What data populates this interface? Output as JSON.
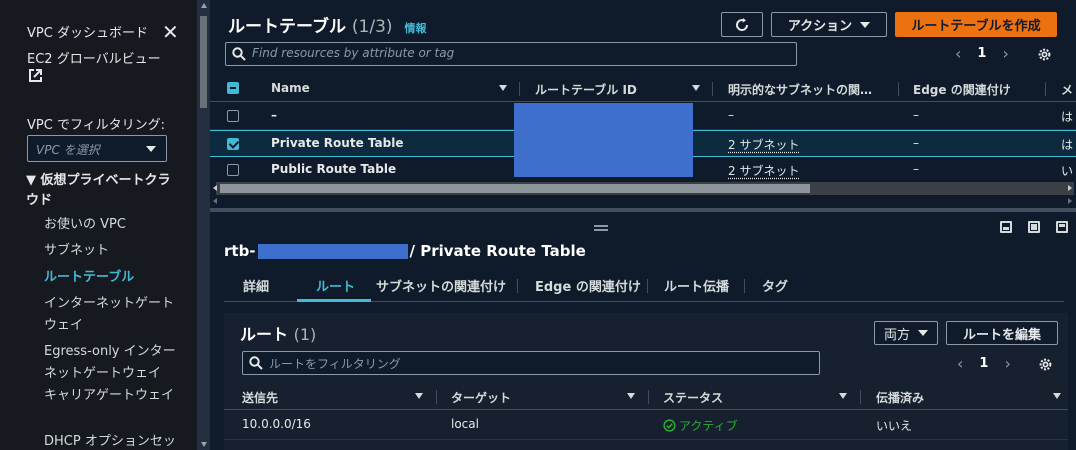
{
  "sidebar": {
    "dashboard": "VPC ダッシュボード",
    "ec2_global_view": "EC2 グローバルビュー",
    "filter_label": "VPC でフィルタリング:",
    "vpc_select_placeholder": "VPC を選択",
    "section": "▼ 仮想プライベートクラウド",
    "items": [
      {
        "label": "お使いの VPC",
        "active": false
      },
      {
        "label": "サブネット",
        "active": false
      },
      {
        "label": "ルートテーブル",
        "active": true
      },
      {
        "label": "インターネットゲートウェイ",
        "active": false
      },
      {
        "label": "Egress-only インターネットゲートウェイ",
        "active": false
      },
      {
        "label": "キャリアゲートウェイ",
        "active": false
      },
      {
        "label": "DHCP オプションセッ",
        "active": false
      }
    ]
  },
  "header": {
    "title": "ルートテーブル",
    "count": "(1/3)",
    "info": "情報",
    "actions_label": "アクション",
    "create_label": "ルートテーブルを作成",
    "search_placeholder": "Find resources by attribute or tag",
    "page": "1"
  },
  "table": {
    "columns": [
      "Name",
      "ルートテーブル ID",
      "明示的なサブネットの関…",
      "Edge の関連付け",
      "メ"
    ],
    "rows": [
      {
        "name": "–",
        "subnets": "–",
        "edge": "–",
        "main": "は",
        "selected": false
      },
      {
        "name": "Private Route Table",
        "subnets": "2 サブネット",
        "edge": "–",
        "main": "は",
        "selected": true
      },
      {
        "name": "Public Route Table",
        "subnets": "2 サブネット",
        "edge": "–",
        "main": "い",
        "selected": false
      }
    ]
  },
  "detail": {
    "id_prefix": "rtb-",
    "title_suffix": "/ Private Route Table",
    "tabs": [
      "詳細",
      "ルート",
      "サブネットの関連付け",
      "Edge の関連付け",
      "ルート伝播",
      "タグ"
    ],
    "active_tab": "ルート"
  },
  "routes": {
    "title": "ルート",
    "count": "(1)",
    "filter_value": "両方",
    "edit_label": "ルートを編集",
    "search_placeholder": "ルートをフィルタリング",
    "page": "1",
    "columns": [
      "送信先",
      "ターゲット",
      "ステータス",
      "伝播済み"
    ],
    "rows": [
      {
        "destination": "10.0.0.0/16",
        "target": "local",
        "status": "アクティブ",
        "propagated": "いいえ"
      }
    ]
  },
  "colors": {
    "accent": "#44b9d6",
    "primary_button": "#ec7211",
    "status_active": "#29ad32",
    "redaction": "#3f6fcd"
  }
}
